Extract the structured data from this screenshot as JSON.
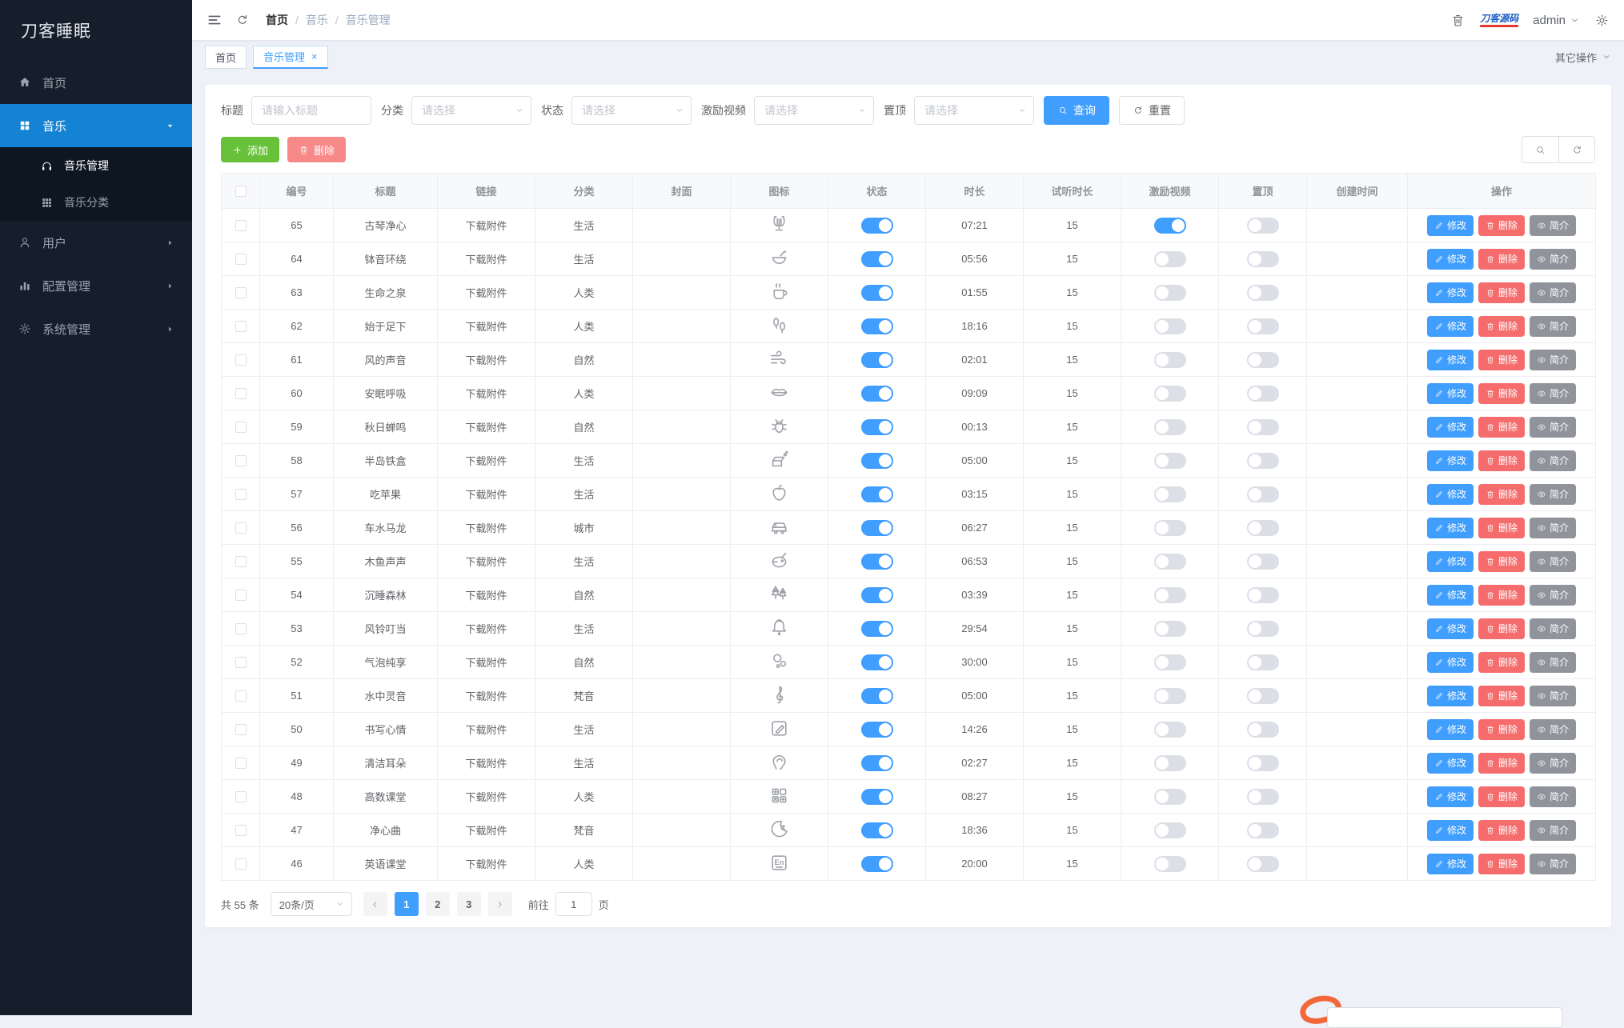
{
  "app": {
    "brand": "刀客睡眠"
  },
  "colors": {
    "accent": "#409eff",
    "success": "#67c23a",
    "danger": "#f56c6c",
    "danger_light": "#f78989",
    "info": "#909399",
    "sidebar_bg": "#151f2b",
    "sidebar_active_bg": "#1583d3",
    "switch_off": "#dcdfe6"
  },
  "sidebar": {
    "items": [
      {
        "key": "home",
        "label": "首页",
        "icon": "home",
        "type": "item",
        "active": false
      },
      {
        "key": "music",
        "label": "音乐",
        "icon": "grid",
        "type": "group",
        "expanded": true,
        "active": true,
        "children": [
          {
            "key": "music-manage",
            "label": "音乐管理",
            "icon": "headphones",
            "active": true
          },
          {
            "key": "music-category",
            "label": "音乐分类",
            "icon": "grid-small",
            "active": false
          }
        ]
      },
      {
        "key": "users",
        "label": "用户",
        "icon": "user",
        "type": "group",
        "expanded": false,
        "active": false
      },
      {
        "key": "config",
        "label": "配置管理",
        "icon": "chart",
        "type": "group",
        "expanded": false,
        "active": false
      },
      {
        "key": "system",
        "label": "系统管理",
        "icon": "settings",
        "type": "group",
        "expanded": false,
        "active": false
      }
    ]
  },
  "header": {
    "breadcrumb": [
      "首页",
      "音乐",
      "音乐管理"
    ],
    "username": "admin",
    "logo_text": "刀客源码"
  },
  "tabbar": {
    "more": "其它操作",
    "tabs": [
      {
        "key": "home",
        "label": "首页",
        "active": false,
        "closable": false
      },
      {
        "key": "music-manage",
        "label": "音乐管理",
        "active": true,
        "closable": true
      }
    ]
  },
  "filters": {
    "title": {
      "label": "标题",
      "placeholder": "请输入标题"
    },
    "selects": [
      {
        "key": "category",
        "label": "分类",
        "placeholder": "请选择"
      },
      {
        "key": "status",
        "label": "状态",
        "placeholder": "请选择"
      },
      {
        "key": "incentive",
        "label": "激励视频",
        "placeholder": "请选择"
      },
      {
        "key": "top",
        "label": "置顶",
        "placeholder": "请选择"
      }
    ],
    "search": "查询",
    "reset": "重置"
  },
  "toolbar": {
    "add": "添加",
    "delete": "删除"
  },
  "table": {
    "columns": [
      "",
      "编号",
      "标题",
      "链接",
      "分类",
      "封面",
      "图标",
      "状态",
      "时长",
      "试听时长",
      "激励视频",
      "置顶",
      "创建时间",
      "操作"
    ],
    "row_actions": [
      {
        "key": "edit",
        "label": "修改"
      },
      {
        "key": "delete",
        "label": "删除"
      },
      {
        "key": "intro",
        "label": "简介"
      }
    ],
    "rows": [
      {
        "id": "65",
        "title": "古琴净心",
        "link": "下载附件",
        "category": "生活",
        "cover": "",
        "icon": "lyre",
        "status": true,
        "duration": "07:21",
        "trial": "15",
        "incentive": true,
        "top": false,
        "created": ""
      },
      {
        "id": "64",
        "title": "钵音环绕",
        "link": "下载附件",
        "category": "生活",
        "cover": "",
        "icon": "singing-bowl",
        "status": true,
        "duration": "05:56",
        "trial": "15",
        "incentive": false,
        "top": false,
        "created": ""
      },
      {
        "id": "63",
        "title": "生命之泉",
        "link": "下载附件",
        "category": "人类",
        "cover": "",
        "icon": "hot-drink",
        "status": true,
        "duration": "01:55",
        "trial": "15",
        "incentive": false,
        "top": false,
        "created": ""
      },
      {
        "id": "62",
        "title": "始于足下",
        "link": "下载附件",
        "category": "人类",
        "cover": "",
        "icon": "footprints",
        "status": true,
        "duration": "18:16",
        "trial": "15",
        "incentive": false,
        "top": false,
        "created": ""
      },
      {
        "id": "61",
        "title": "风的声音",
        "link": "下载附件",
        "category": "自然",
        "cover": "",
        "icon": "wind",
        "status": true,
        "duration": "02:01",
        "trial": "15",
        "incentive": false,
        "top": false,
        "created": ""
      },
      {
        "id": "60",
        "title": "安眠呼吸",
        "link": "下载附件",
        "category": "人类",
        "cover": "",
        "icon": "lips",
        "status": true,
        "duration": "09:09",
        "trial": "15",
        "incentive": false,
        "top": false,
        "created": ""
      },
      {
        "id": "59",
        "title": "秋日蝉鸣",
        "link": "下载附件",
        "category": "自然",
        "cover": "",
        "icon": "cicada",
        "status": true,
        "duration": "00:13",
        "trial": "15",
        "incentive": false,
        "top": false,
        "created": ""
      },
      {
        "id": "58",
        "title": "半岛铁盒",
        "link": "下载附件",
        "category": "生活",
        "cover": "",
        "icon": "music-box",
        "status": true,
        "duration": "05:00",
        "trial": "15",
        "incentive": false,
        "top": false,
        "created": ""
      },
      {
        "id": "57",
        "title": "吃苹果",
        "link": "下载附件",
        "category": "生活",
        "cover": "",
        "icon": "apple",
        "status": true,
        "duration": "03:15",
        "trial": "15",
        "incentive": false,
        "top": false,
        "created": ""
      },
      {
        "id": "56",
        "title": "车水马龙",
        "link": "下载附件",
        "category": "城市",
        "cover": "",
        "icon": "car",
        "status": true,
        "duration": "06:27",
        "trial": "15",
        "incentive": false,
        "top": false,
        "created": ""
      },
      {
        "id": "55",
        "title": "木鱼声声",
        "link": "下载附件",
        "category": "生活",
        "cover": "",
        "icon": "wooden-fish",
        "status": true,
        "duration": "06:53",
        "trial": "15",
        "incentive": false,
        "top": false,
        "created": ""
      },
      {
        "id": "54",
        "title": "沉睡森林",
        "link": "下载附件",
        "category": "自然",
        "cover": "",
        "icon": "forest",
        "status": true,
        "duration": "03:39",
        "trial": "15",
        "incentive": false,
        "top": false,
        "created": ""
      },
      {
        "id": "53",
        "title": "风铃叮当",
        "link": "下载附件",
        "category": "生活",
        "cover": "",
        "icon": "bell",
        "status": true,
        "duration": "29:54",
        "trial": "15",
        "incentive": false,
        "top": false,
        "created": ""
      },
      {
        "id": "52",
        "title": "气泡纯享",
        "link": "下载附件",
        "category": "自然",
        "cover": "",
        "icon": "bubbles",
        "status": true,
        "duration": "30:00",
        "trial": "15",
        "incentive": false,
        "top": false,
        "created": ""
      },
      {
        "id": "51",
        "title": "水中灵音",
        "link": "下载附件",
        "category": "梵音",
        "cover": "",
        "icon": "treble-clef",
        "status": true,
        "duration": "05:00",
        "trial": "15",
        "incentive": false,
        "top": false,
        "created": ""
      },
      {
        "id": "50",
        "title": "书写心情",
        "link": "下载附件",
        "category": "生活",
        "cover": "",
        "icon": "writing",
        "status": true,
        "duration": "14:26",
        "trial": "15",
        "incentive": false,
        "top": false,
        "created": ""
      },
      {
        "id": "49",
        "title": "清洁耳朵",
        "link": "下载附件",
        "category": "生活",
        "cover": "",
        "icon": "ear",
        "status": true,
        "duration": "02:27",
        "trial": "15",
        "incentive": false,
        "top": false,
        "created": ""
      },
      {
        "id": "48",
        "title": "高数课堂",
        "link": "下载附件",
        "category": "人类",
        "cover": "",
        "icon": "calculator",
        "status": true,
        "duration": "08:27",
        "trial": "15",
        "incentive": false,
        "top": false,
        "created": ""
      },
      {
        "id": "47",
        "title": "净心曲",
        "link": "下载附件",
        "category": "梵音",
        "cover": "",
        "icon": "moon",
        "status": true,
        "duration": "18:36",
        "trial": "15",
        "incentive": false,
        "top": false,
        "created": ""
      },
      {
        "id": "46",
        "title": "英语课堂",
        "link": "下载附件",
        "category": "人类",
        "cover": "",
        "icon": "english",
        "status": true,
        "duration": "20:00",
        "trial": "15",
        "incentive": false,
        "top": false,
        "created": ""
      }
    ]
  },
  "pagination": {
    "total": "共 55 条",
    "size": "20条/页",
    "pages": [
      "1",
      "2",
      "3"
    ],
    "active": "1",
    "jump_label": "前往",
    "jump_value": "1",
    "jump_suffix": "页"
  }
}
